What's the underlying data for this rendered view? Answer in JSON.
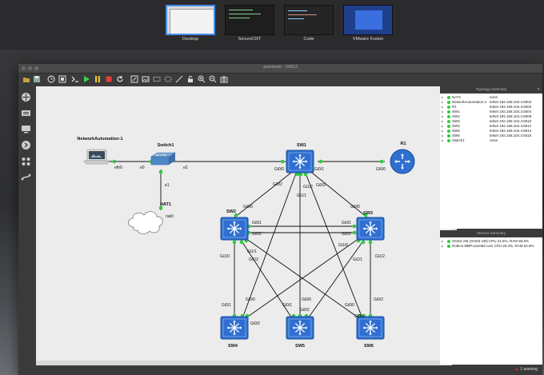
{
  "mission_control": {
    "spaces": [
      {
        "label": "Desktop",
        "active": true
      },
      {
        "label": "SecureCRT",
        "active": false
      },
      {
        "label": "Code",
        "active": false
      },
      {
        "label": "VMware Fusion",
        "active": false
      }
    ]
  },
  "window": {
    "title": "automate - GNS3"
  },
  "topology": {
    "nodes": {
      "host": "NetworkAutomation-1",
      "switch1": "Switch1",
      "nat": "NAT1",
      "sw1": "SW1",
      "sw2": "SW2",
      "sw3": "SW3",
      "sw4": "SW4",
      "sw5": "SW5",
      "sw6": "SW6",
      "r1": "R1"
    },
    "ports": {
      "eth0": "eth0",
      "e0": "e0",
      "e1": "e1",
      "e2": "e2",
      "nat0": "nat0",
      "gi00": "Gi0/0",
      "gi01": "Gi0/1",
      "gi02": "Gi0/2",
      "gi03": "Gi0/3",
      "gi10": "Gi1/0",
      "gi11": "Gi1/1",
      "gi12": "Gi1/2"
    }
  },
  "topology_summary": {
    "title": "Topology Summary",
    "rows": [
      {
        "name": "NAT1",
        "console": "none"
      },
      {
        "name": "NetworkAutomation-1",
        "console": "telnet 192.168.104.4:5003"
      },
      {
        "name": "R1",
        "console": "telnet 192.168.104.4:5002"
      },
      {
        "name": "SW1",
        "console": "telnet 192.168.104.4:5004"
      },
      {
        "name": "SW2",
        "console": "telnet 192.168.104.4:5008"
      },
      {
        "name": "SW3",
        "console": "telnet 192.168.104.4:5010"
      },
      {
        "name": "SW4",
        "console": "telnet 192.168.104.4:5012"
      },
      {
        "name": "SW5",
        "console": "telnet 192.168.104.4:5014"
      },
      {
        "name": "SW6",
        "console": "telnet 192.168.104.4:5016"
      },
      {
        "name": "Switch1",
        "console": "none"
      }
    ]
  },
  "servers_summary": {
    "title": "Servers Summary",
    "rows": [
      {
        "text": "GNS3 VM (GNS3 VM) CPU 21.5%, RAM 68.8%"
      },
      {
        "text": "Robins-MBP.canetail.com CPU 25.0%, RAM 64.8%"
      }
    ]
  },
  "status": {
    "warning": "1 warning"
  },
  "colors": {
    "switch_blue": "#2f6fd1",
    "link_green": "#2ecc40",
    "accent": "#4a8ff0"
  }
}
